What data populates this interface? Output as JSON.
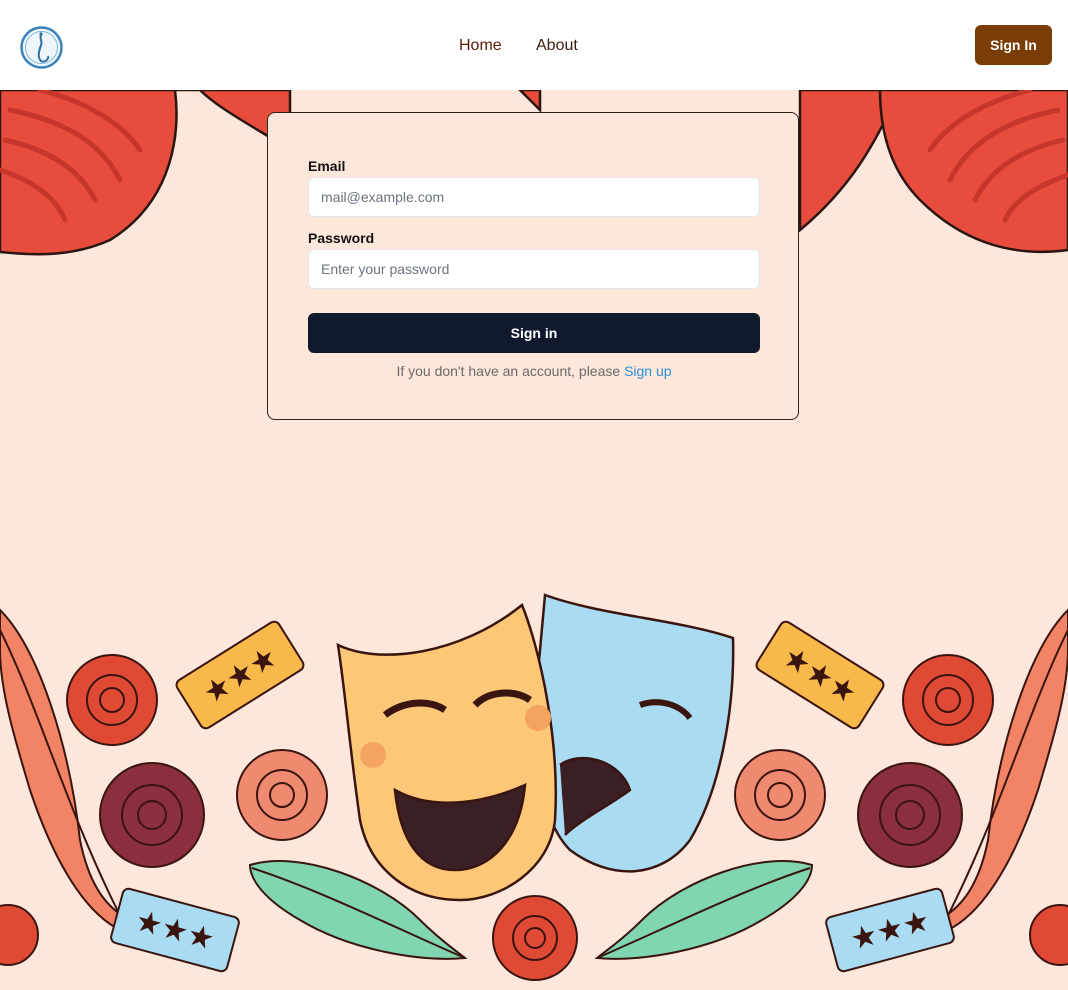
{
  "nav": {
    "links": [
      {
        "label": "Home"
      },
      {
        "label": "About"
      }
    ],
    "signin_label": "Sign In"
  },
  "form": {
    "email_label": "Email",
    "email_placeholder": "mail@example.com",
    "password_label": "Password",
    "password_placeholder": "Enter your password",
    "submit_label": "Sign in",
    "signup_prompt": "If you don't have an account, please",
    "signup_link": "Sign up"
  },
  "colors": {
    "background": "#fde6da",
    "brand_button": "#7a3d06",
    "submit_button": "#111a2c",
    "link": "#2b8fd6",
    "curtain": "#e74c3c"
  }
}
